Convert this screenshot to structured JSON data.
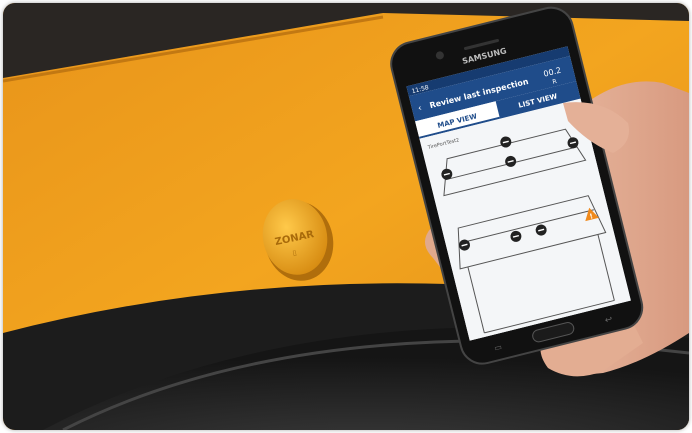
{
  "phone": {
    "brand": "SAMSUNG",
    "status_time": "11:58",
    "header_title": "Review last inspection",
    "header_right_label": "R",
    "header_right_value": "00.2",
    "tabs": [
      "MAP VIEW",
      "LIST VIEW"
    ],
    "map_caption": "TirePortTest2"
  },
  "device_logo": "ZONAR",
  "colors": {
    "bus_yellow": "#f2a51d",
    "app_header": "#1f4c8a",
    "alert_orange": "#f08a1c"
  }
}
